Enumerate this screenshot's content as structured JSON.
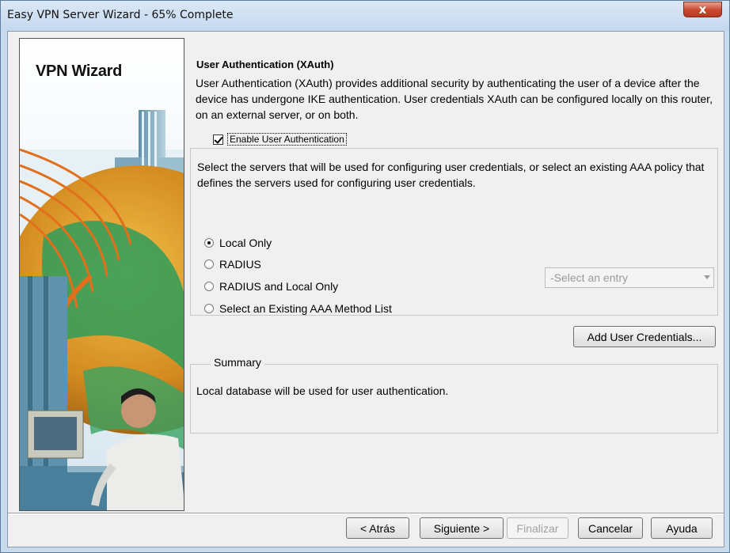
{
  "window": {
    "title": "Easy VPN Server Wizard - 65% Complete",
    "progress_percent": 65,
    "close_label": "x"
  },
  "sidebar": {
    "heading": "VPN Wizard"
  },
  "main": {
    "section_title": "User Authentication (XAuth)",
    "description": "User Authentication (XAuth) provides additional security by authenticating the user of a device after the device has undergone IKE authentication. User credentials XAuth can be configured locally on this router, on an external server, or on both.",
    "enable_checkbox": {
      "label": "Enable User Authentication",
      "checked": true
    },
    "servers_description": "Select the servers that will be used for configuring user credentials, or select an existing AAA policy that defines the servers used for configuring user credentials.",
    "radios": [
      {
        "label": "Local Only",
        "selected": true
      },
      {
        "label": "RADIUS",
        "selected": false
      },
      {
        "label": "RADIUS and Local Only",
        "selected": false
      },
      {
        "label": "Select an Existing AAA Method List",
        "selected": false
      }
    ],
    "method_select": {
      "value": "-Select an entry",
      "disabled": true
    },
    "add_credentials_label": "Add User Credentials...",
    "summary": {
      "title": "Summary",
      "text": "Local database will be used for user authentication."
    }
  },
  "footer": {
    "back_label": "< Atrás",
    "next_label": "Siguiente >",
    "finish_label": "Finalizar",
    "cancel_label": "Cancelar",
    "help_label": "Ayuda"
  },
  "colors": {
    "titlebar": "#c4d8ee",
    "close_button": "#c9472e",
    "dialog_background": "#f0f0f0"
  }
}
